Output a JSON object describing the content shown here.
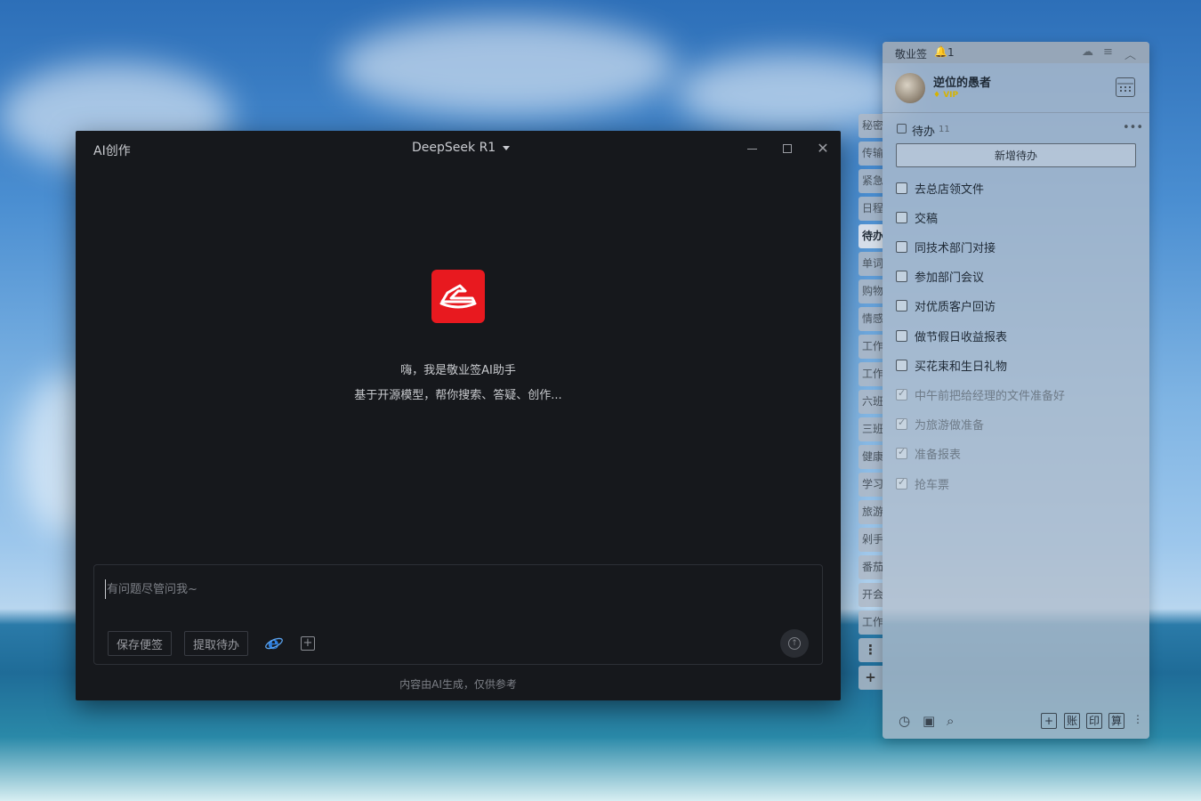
{
  "ai_window": {
    "title": "AI创作",
    "model": "DeepSeek R1",
    "greeting_line1": "嗨，我是敬业签AI助手",
    "greeting_line2": "基于开源模型，帮你搜索、答疑、创作...",
    "input_placeholder": "有问题尽管问我~",
    "buttons": {
      "save_note": "保存便签",
      "extract_todo": "提取待办"
    },
    "disclaimer": "内容由AI生成，仅供参考"
  },
  "side_tabs": [
    "秘密",
    "传输",
    "紧急",
    "日程",
    "待办",
    "单词",
    "购物",
    "情感",
    "工作",
    "工作",
    "六班",
    "三班",
    "健康",
    "学习",
    "旅游",
    "剁手",
    "番茄",
    "开会",
    "工作"
  ],
  "side_tab_active": "待办",
  "notes_panel": {
    "app_name": "敬业签",
    "notification_count": "1",
    "username": "逆位的愚者",
    "vip_label": "VIP",
    "section": {
      "title": "待办",
      "count": "11"
    },
    "add_button": "新增待办",
    "todos": [
      {
        "text": "去总店领文件",
        "done": false
      },
      {
        "text": "交稿",
        "done": false
      },
      {
        "text": "同技术部门对接",
        "done": false
      },
      {
        "text": "参加部门会议",
        "done": false
      },
      {
        "text": "对优质客户回访",
        "done": false
      },
      {
        "text": "做节假日收益报表",
        "done": false
      },
      {
        "text": "买花束和生日礼物",
        "done": false
      },
      {
        "text": "中午前把给经理的文件准备好",
        "done": true
      },
      {
        "text": "为旅游做准备",
        "done": true
      },
      {
        "text": "准备报表",
        "done": true
      },
      {
        "text": "抢车票",
        "done": true
      }
    ],
    "bottom_tools": {
      "ledger": "账",
      "print": "印",
      "calc": "算"
    }
  },
  "colors": {
    "brand_red": "#e8191f",
    "dark_bg": "#16181c",
    "vip_gold": "#d6b300"
  }
}
